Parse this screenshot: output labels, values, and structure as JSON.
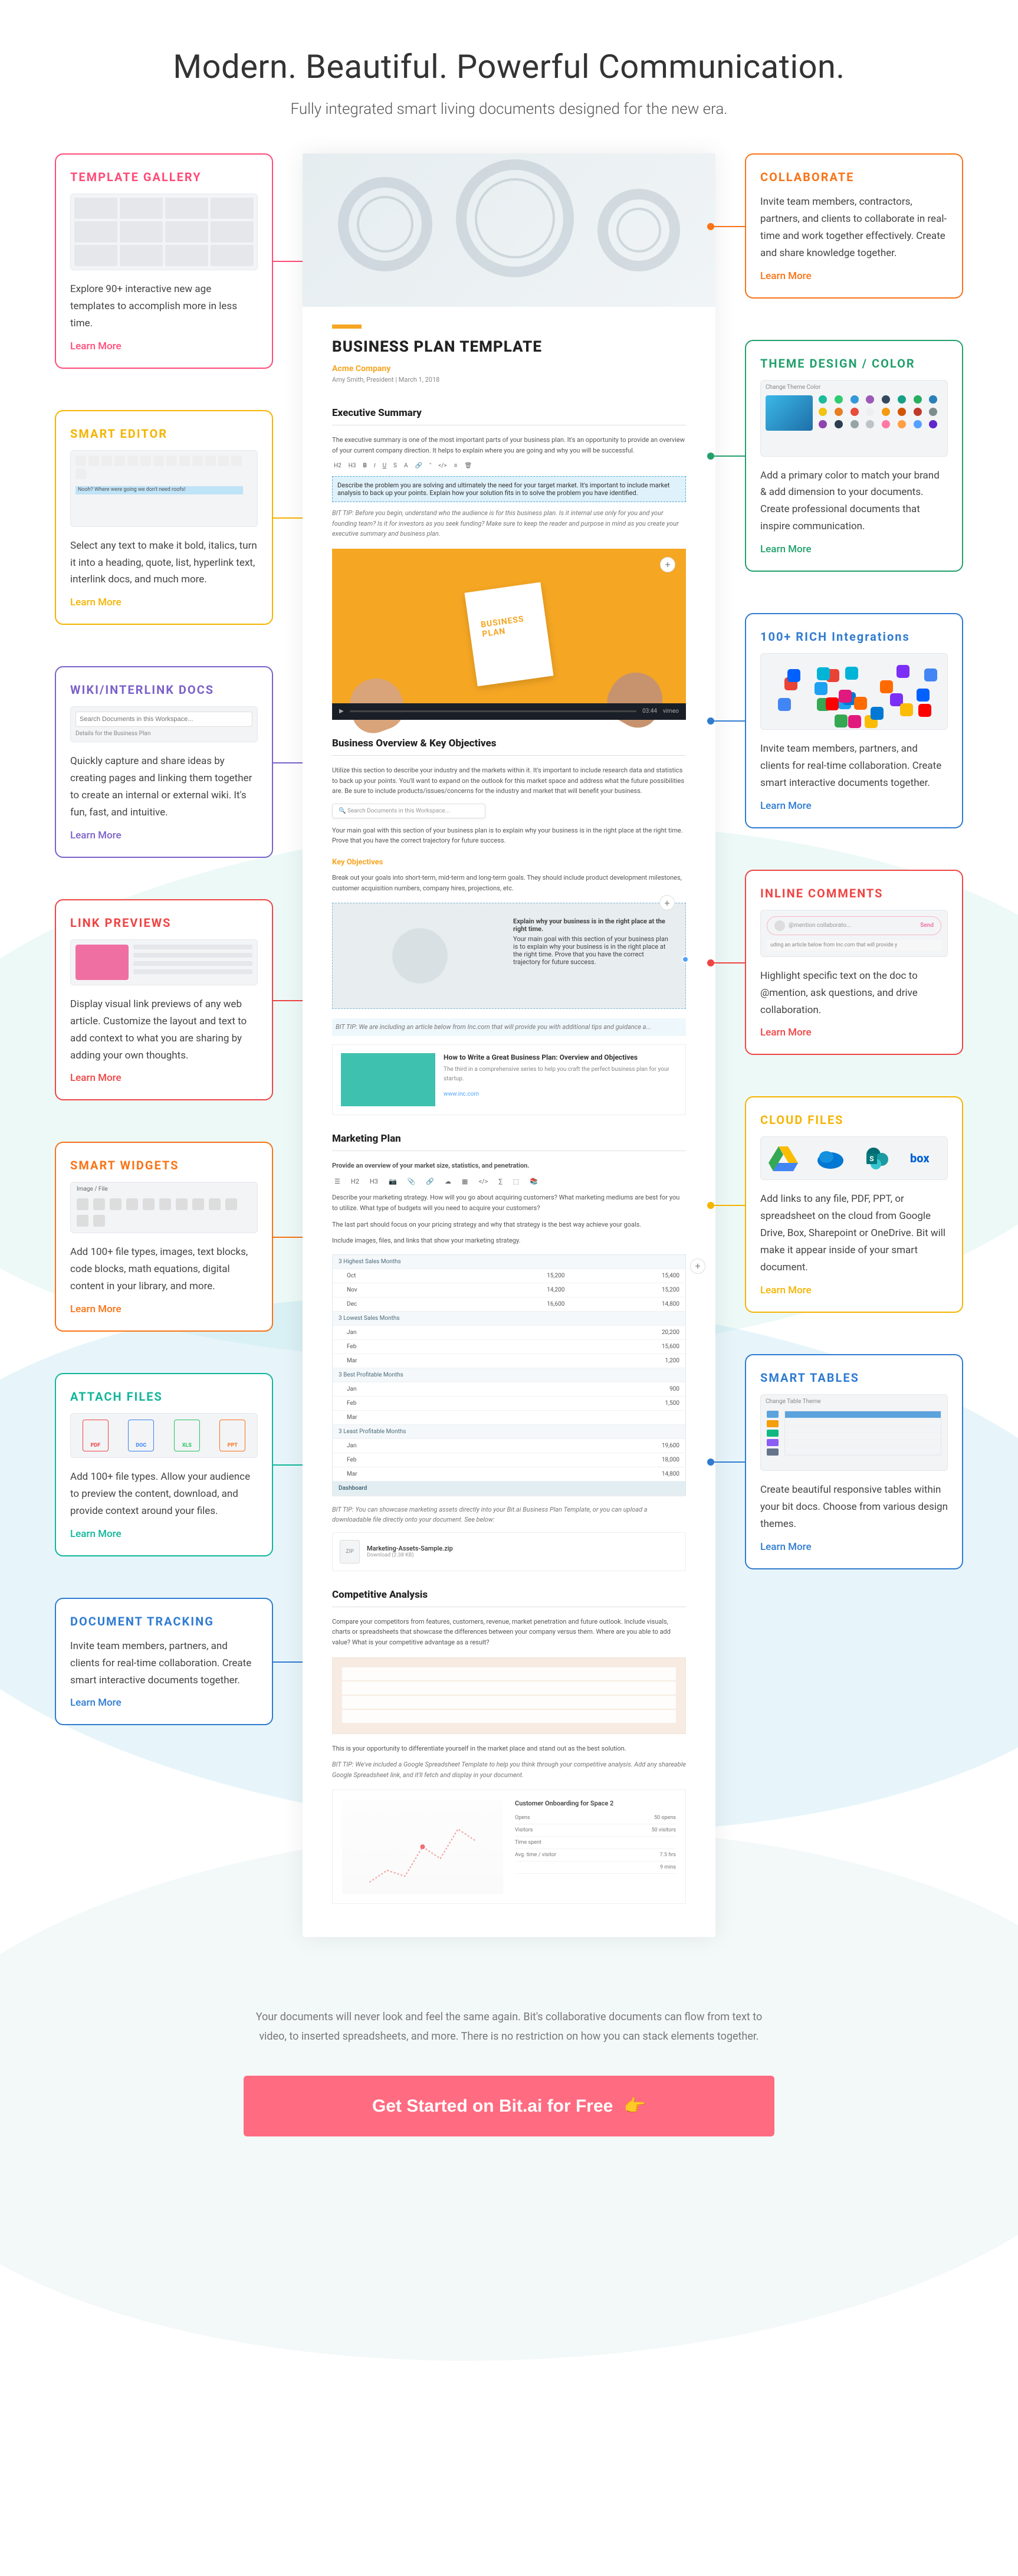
{
  "header": {
    "title": "Modern. Beautiful. Powerful Communication.",
    "subtitle": "Fully integrated smart living documents designed for the new era."
  },
  "colors": {
    "pink": "#ff4b77",
    "yellow": "#f5b400",
    "purple": "#7b61c9",
    "red": "#ef4444",
    "orange": "#f97316",
    "teal": "#10b69a",
    "blue": "#2f7bd1",
    "green": "#22a06b"
  },
  "left_cards": [
    {
      "key": "template_gallery",
      "title": "TEMPLATE GALLERY",
      "color": "pink",
      "desc": "Explore 90+ interactive new age templates to accomplish more in less time.",
      "learn": "Learn More",
      "preview": "thumb-grid"
    },
    {
      "key": "smart_editor",
      "title": "SMART EDITOR",
      "color": "yellow",
      "desc": "Select any text to make it bold, italics, turn it into a heading, quote, list, hyperlink text, interlink docs, and much more.",
      "learn": "Learn More",
      "preview": "mini-toolbar",
      "toolbar_caption": "Nooh? Where were going we don't need roofs!"
    },
    {
      "key": "wiki",
      "title": "WIKI/INTERLINK DOCS",
      "color": "purple",
      "desc": "Quickly capture and share ideas by creating pages and linking them together to create an internal or external wiki. It's fun, fast, and intuitive.",
      "learn": "Learn More",
      "preview": "mini-search",
      "search_placeholder": "Search Documents in this Workspace...",
      "search_caption": "Details for the Business Plan"
    },
    {
      "key": "link_previews",
      "title": "LINK PREVIEWS",
      "color": "red",
      "desc": "Display visual link previews of any web article. Customize the layout and text to add context to what you are sharing by adding your own thoughts.",
      "learn": "Learn More",
      "preview": "link-prev-mini"
    },
    {
      "key": "smart_widgets",
      "title": "SMART WIDGETS",
      "color": "orange",
      "desc": "Add 100+ file types, images, text blocks, code blocks, math equations, digital content in your library, and more.",
      "learn": "Learn More",
      "preview": "widget-icons"
    },
    {
      "key": "attach_files",
      "title": "ATTACH FILES",
      "color": "teal",
      "desc": "Add 100+ file types. Allow your audience to preview the content, download, and provide context around your files.",
      "learn": "Learn More",
      "preview": "file-icons",
      "file_labels": [
        "PDF",
        "DOC",
        "XLS",
        "PPT"
      ]
    },
    {
      "key": "doc_tracking",
      "title": "DOCUMENT TRACKING",
      "color": "blue",
      "desc": "Invite team members, partners, and clients for real-time collaboration. Create smart interactive documents together.",
      "learn": "Learn More",
      "preview": "none"
    }
  ],
  "right_cards": [
    {
      "key": "collaborate",
      "title": "COLLABORATE",
      "color": "orange",
      "desc": "Invite team members, contractors, partners, and clients to collaborate in real-time and work together effectively. Create and share knowledge together.",
      "learn": "Learn More",
      "preview": "none"
    },
    {
      "key": "theme",
      "title": "THEME DESIGN / COLOR",
      "color": "green",
      "desc": "Add a primary color to match your brand & add dimension to your documents. Create professional documents that inspire communication.",
      "learn": "Learn More",
      "preview": "color-grid",
      "preview_caption": "Change Theme Color"
    },
    {
      "key": "integrations",
      "title": "100+ RICH Integrations",
      "color": "blue",
      "desc": "Invite team members, partners, and clients for real-time collaboration. Create smart interactive documents together.",
      "learn": "Learn More",
      "preview": "integ-cloud"
    },
    {
      "key": "comments",
      "title": "INLINE COMMENTS",
      "color": "red",
      "desc": "Highlight specific text on the doc to @mention, ask questions, and drive collaboration.",
      "learn": "Learn More",
      "preview": "comment-mini",
      "bubble": "@mention collaborato...",
      "bubble_send": "Send",
      "line": "uding an article below from Inc.com that will provide y"
    },
    {
      "key": "cloud",
      "title": "CLOUD FILES",
      "color": "yellow",
      "desc": "Add links to any file, PDF, PPT, or spreadsheet on the cloud from Google Drive, Box, Sharepoint or OneDrive. Bit will make it appear inside of your smart document.",
      "learn": "Learn More",
      "preview": "cloud-icons"
    },
    {
      "key": "tables",
      "title": "SMART TABLES",
      "color": "blue",
      "desc": "Create beautiful responsive tables within your bit docs. Choose from various design themes.",
      "learn": "Learn More",
      "preview": "tables-mini",
      "preview_caption": "Change Table Theme"
    }
  ],
  "doc": {
    "title": "BUSINESS PLAN TEMPLATE",
    "company": "Acme Company",
    "meta": "Amy Smith, President | March 1, 2018",
    "sections": {
      "exec_summary": {
        "heading": "Executive Summary",
        "para1": "The executive summary is one of the most important parts of your business plan. It's an opportunity to provide an overview of your current company direction. It helps to explain where you are going and why you will be successful.",
        "highlight": "Describe the problem you are solving and ultimately the need for your target market. It's important to include market analysis to back up your points. Explain how your solution fits in to solve the problem you have identified.",
        "tip": "BIT TIP: Before you begin, understand who the audience is for this business plan. Is it internal use only for you and your founding team? Is it for investors as you seek funding? Make sure to keep the reader and purpose in mind as you create your executive summary and business plan."
      },
      "overview": {
        "heading": "Business Overview & Key Objectives",
        "para1": "Utilize this section to describe your industry and the markets within it. It's important to include research data and statistics to back up your points. You'll want to expand on the outlook for this market space and address what the future possibilities are. Be sure to include products/issues/concerns for the industry and market that will benefit your business.",
        "search_placeholder": "Search Documents in this Workspace...",
        "para2": "Your main goal with this section of your business plan is to explain why your business is in the right place at the right time. Prove that you have the correct trajectory for future success.",
        "key_obj_heading": "Key Objectives",
        "para3": "Break out your goals into short-term, mid-term and long-term goals. They should include product development milestones, customer acquisition numbers, company hires, projections, etc.",
        "explain_title": "Explain why your business is in the right place at the right time.",
        "explain_body": "Your main goal with this section of your business plan is to explain why your business is in the right place at the right time. Prove that you have the correct trajectory for future success.",
        "tip": "BIT TIP: We are including an article below from Inc.com that will provide you with additional tips and guidance a...",
        "article_title": "How to Write a Great Business Plan: Overview and Objectives",
        "article_sub": "The third in a comprehensive series to help you craft the perfect business plan for your startup.",
        "article_link": "www.inc.com"
      },
      "marketing": {
        "heading": "Marketing Plan",
        "para1": "Provide an overview of your market size, statistics, and penetration.",
        "para2": "Describe your marketing strategy. How will you go about acquiring customers? What marketing mediums are best for you to utilize. What type of budgets will you need to acquire your customers?",
        "para3": "The last part should focus on your pricing strategy and why that strategy is the best way achieve your goals.",
        "para4": "Include images, files, and links that show your marketing strategy.",
        "sheet": {
          "months_header": "3 Highest Sales Months",
          "lowest_header": "3 Lowest Sales Months",
          "profit_header": "3 Best Profitable Months",
          "least_profit_header": "3 Least Profitable Months",
          "rows_high": [
            {
              "m": "Oct",
              "a": "15,200",
              "b": "15,400"
            },
            {
              "m": "Nov",
              "a": "14,200",
              "b": "15,200"
            },
            {
              "m": "Dec",
              "a": "16,600",
              "b": "14,800"
            }
          ],
          "rows_low": [
            {
              "m": "Jan",
              "a": "",
              "b": "20,200"
            },
            {
              "m": "Feb",
              "a": "",
              "b": "15,600"
            },
            {
              "m": "Mar",
              "a": "",
              "b": "1,200"
            }
          ],
          "rows_profit": [
            {
              "m": "Jan",
              "a": "",
              "b": "900"
            },
            {
              "m": "Feb",
              "a": "",
              "b": "1,500"
            },
            {
              "m": "Mar",
              "a": "",
              "b": ""
            }
          ],
          "rows_least": [
            {
              "m": "Jan",
              "a": "",
              "b": "19,600"
            },
            {
              "m": "Feb",
              "a": "",
              "b": "18,000"
            },
            {
              "m": "Mar",
              "a": "",
              "b": "14,800"
            }
          ],
          "footer": "Dashboard"
        },
        "tip": "BIT TIP: You can showcase marketing assets directly into your Bit.ai Business Plan Template, or you can upload a downloadable file directly onto your document. See below:",
        "file_name": "Marketing-Assets-Sample.zip",
        "file_size": "Download (2.38 KB)"
      },
      "competitive": {
        "heading": "Competitive Analysis",
        "para1": "Compare your competitors from features, customers, revenue, market penetration and future outlook. Include visuals, charts or spreadsheets that showcase the differences between your company versus them. Where are you able to add value? What is your competitive advantage as a result?",
        "para2": "This is your opportunity to differentiate yourself in the market place and stand out as the best solution.",
        "tip": "BIT TIP: We've included a Google Spreadsheet Template to help you think through your competitive analysis. Add any shareable Google Spreadsheet link, and it'll fetch and display in your document.",
        "tracking_title": "Customer Onboarding for Space 2",
        "tracking_rows": [
          {
            "l": "Opens",
            "v": "50 opens"
          },
          {
            "l": "Visitors",
            "v": "50 visitors"
          },
          {
            "l": "Time spent",
            "v": ""
          },
          {
            "l": "Avg. time / visitor",
            "v": "7.5 hrs"
          },
          {
            "l": "",
            "v": "9 mins"
          }
        ]
      }
    },
    "video_brand": "vimeo",
    "video_time": "03:44"
  },
  "footer_para": "Your documents will never look and feel the same again. Bit's collaborative documents can flow from text to video, to inserted spreadsheets, and more. There is no restriction on how you can stack elements together.",
  "cta": "Get Started on Bit.ai for Free",
  "cta_emoji": "👉"
}
